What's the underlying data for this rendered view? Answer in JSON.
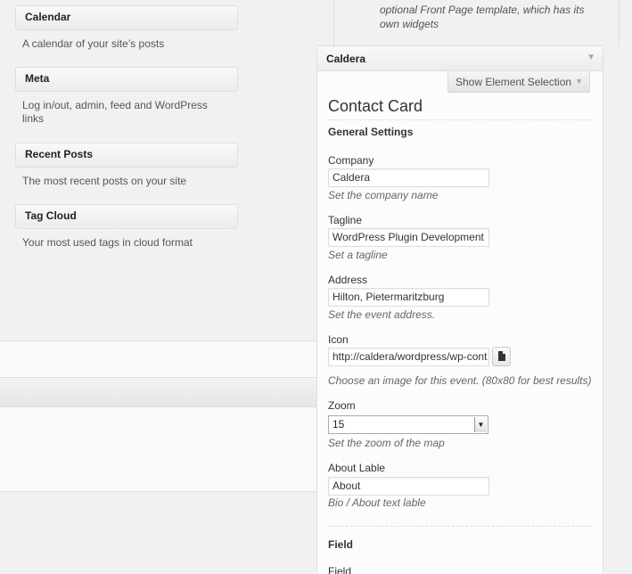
{
  "available_widgets": [
    {
      "title": "Calendar",
      "description": "A calendar of your site’s posts"
    },
    {
      "title": "Meta",
      "description": "Log in/out, admin, feed and WordPress links"
    },
    {
      "title": "Recent Posts",
      "description": "The most recent posts on your site"
    },
    {
      "title": "Tag Cloud",
      "description": "Your most used tags in cloud format"
    }
  ],
  "sidebar": {
    "description": "optional Front Page template, which has its own widgets"
  },
  "widget": {
    "header": "Caldera",
    "show_selection_label": "Show Element Selection",
    "title": "Contact Card",
    "general_settings": "General Settings",
    "fields": {
      "company": {
        "label": "Company",
        "value": "Caldera",
        "help": "Set the company name"
      },
      "tagline": {
        "label": "Tagline",
        "value": "WordPress Plugin Development",
        "help": "Set a tagline"
      },
      "address": {
        "label": "Address",
        "value": "Hilton, Pietermaritzburg",
        "help": "Set the event address."
      },
      "icon": {
        "label": "Icon",
        "value": "http://caldera/wordpress/wp-cont",
        "help": "Choose an image for this event. (80x80 for best results)"
      },
      "zoom": {
        "label": "Zoom",
        "value": "15",
        "help": "Set the zoom of the map"
      },
      "about": {
        "label": "About Lable",
        "value": "About",
        "help": "Bio / About text lable"
      }
    },
    "field_section": "Field",
    "field_label": "Field"
  }
}
